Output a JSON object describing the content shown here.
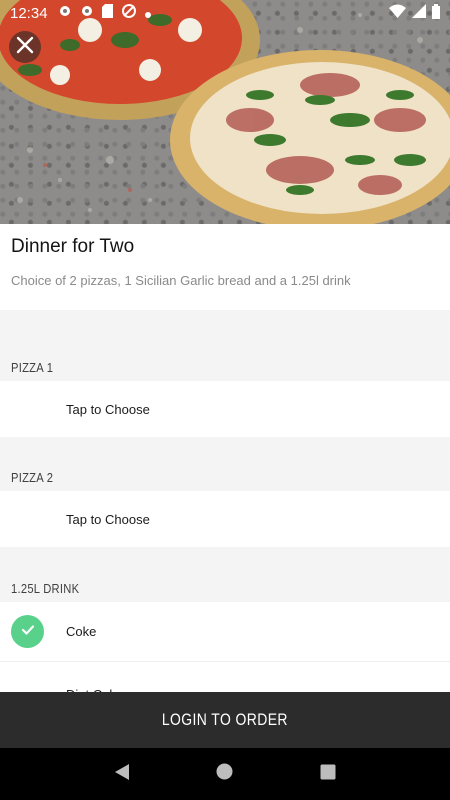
{
  "status_bar": {
    "time": "12:34",
    "left_icons": [
      "gear-icon",
      "gear-icon",
      "sd-card-icon",
      "location-blocked-icon",
      "dot-icon"
    ],
    "right_icons": [
      "wifi-icon",
      "signal-icon",
      "battery-icon"
    ]
  },
  "deal": {
    "title": "Dinner for Two",
    "description": "Choice of 2 pizzas, 1 Sicilian Garlic bread and a 1.25l drink"
  },
  "sections": [
    {
      "label": "PIZZA 1",
      "option": "Tap to Choose"
    },
    {
      "label": "PIZZA 2",
      "option": "Tap to Choose"
    },
    {
      "label": "1.25L DRINK",
      "options": [
        {
          "label": "Coke",
          "selected": true
        },
        {
          "label": "Diet Coke",
          "selected": false
        }
      ]
    }
  ],
  "login_button": {
    "label": "LOGIN TO ORDER"
  },
  "colors": {
    "accent_check": "#59d18a",
    "button_bg": "#2c2c2c"
  }
}
